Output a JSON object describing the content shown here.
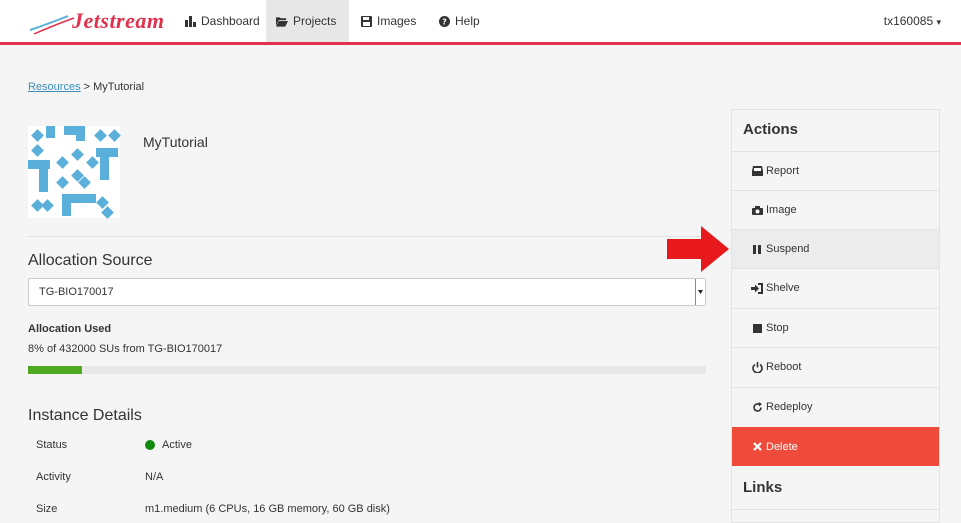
{
  "navbar": {
    "logo_text": "Jetstream",
    "items": [
      {
        "label": "Dashboard",
        "icon": "bar-chart-icon",
        "active": false
      },
      {
        "label": "Projects",
        "icon": "folder-open-icon",
        "active": true
      },
      {
        "label": "Images",
        "icon": "floppy-disk-icon",
        "active": false
      },
      {
        "label": "Help",
        "icon": "question-circle-icon",
        "active": false
      }
    ],
    "user": "tx160085",
    "user_caret": "▾"
  },
  "breadcrumb": {
    "link": "Resources",
    "separator": ">",
    "current": "MyTutorial"
  },
  "project": {
    "name": "MyTutorial"
  },
  "allocation": {
    "title": "Allocation Source",
    "selected": "TG-BIO170017",
    "used_label": "Allocation Used",
    "used_text": "8% of 432000 SUs from TG-BIO170017",
    "used_percent": 8
  },
  "instance_details": {
    "title": "Instance Details",
    "rows": [
      {
        "label": "Status",
        "value": "Active"
      },
      {
        "label": "Activity",
        "value": "N/A"
      },
      {
        "label": "Size",
        "value": "m1.medium (6 CPUs, 16 GB memory, 60 GB disk)"
      }
    ]
  },
  "actions": {
    "title": "Actions",
    "items": [
      {
        "label": "Report",
        "icon": "inbox-icon"
      },
      {
        "label": "Image",
        "icon": "camera-icon"
      },
      {
        "label": "Suspend",
        "icon": "pause-icon"
      },
      {
        "label": "Shelve",
        "icon": "sign-in-icon"
      },
      {
        "label": "Stop",
        "icon": "stop-icon"
      },
      {
        "label": "Reboot",
        "icon": "power-icon"
      },
      {
        "label": "Redeploy",
        "icon": "refresh-icon"
      },
      {
        "label": "Delete",
        "icon": "close-icon"
      }
    ],
    "links_title": "Links"
  },
  "colors": {
    "brand": "#e0314e",
    "delete": "#ef4b3a",
    "progress": "#4ea91f",
    "status_active": "#128a0e",
    "arrow": "#e8191c",
    "identicon": "#5aafdb"
  }
}
